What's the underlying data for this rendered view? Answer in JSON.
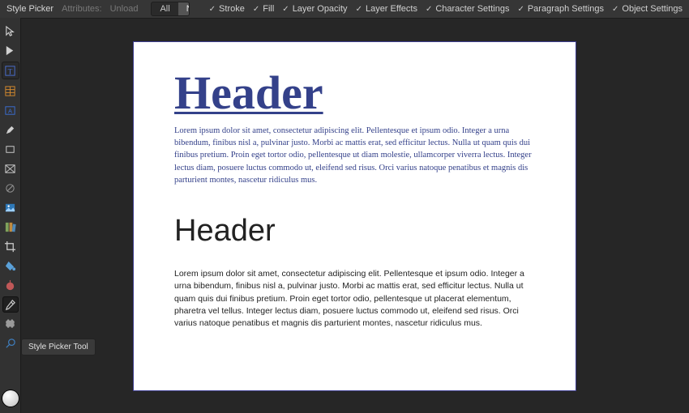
{
  "topbar": {
    "tool_name": "Style Picker",
    "attributes_label": "Attributes:",
    "unload_label": "Unload",
    "all_label": "All",
    "none_label": "None",
    "checks": [
      "Stroke",
      "Fill",
      "Layer Opacity",
      "Layer Effects",
      "Character Settings",
      "Paragraph Settings",
      "Object Settings"
    ]
  },
  "tooltip": "Style Picker Tool",
  "doc": {
    "header1": "Header",
    "lorem1": "Lorem ipsum dolor sit amet, consectetur adipiscing elit. Pellentesque et ipsum odio. Integer a urna bibendum, finibus nisl a, pulvinar justo. Morbi ac mattis erat, sed efficitur lectus. Nulla ut quam quis dui finibus pretium. Proin eget tortor odio, pellentesque ut diam molestie, ullamcorper viverra lectus. Integer lectus diam, posuere luctus commodo ut, eleifend sed risus. Orci varius natoque penatibus et magnis dis parturient montes, nascetur ridiculus mus.",
    "header2": "Header",
    "lorem2": "Lorem ipsum dolor sit amet, consectetur adipiscing elit. Pellentesque et ipsum odio. Integer a urna bibendum, finibus nisl a, pulvinar justo. Morbi ac mattis erat, sed efficitur lectus. Nulla ut quam quis dui finibus pretium. Proin eget tortor odio, pellentesque ut placerat elementum, pharetra vel tellus. Integer lectus diam, posuere luctus commodo ut, eleifend sed risus. Orci varius natoque penatibus et magnis dis parturient montes, nascetur ridiculus mus."
  },
  "colors": {
    "accent_blue": "#34418a",
    "panel_bg": "#323232",
    "canvas_bg": "#262626"
  }
}
